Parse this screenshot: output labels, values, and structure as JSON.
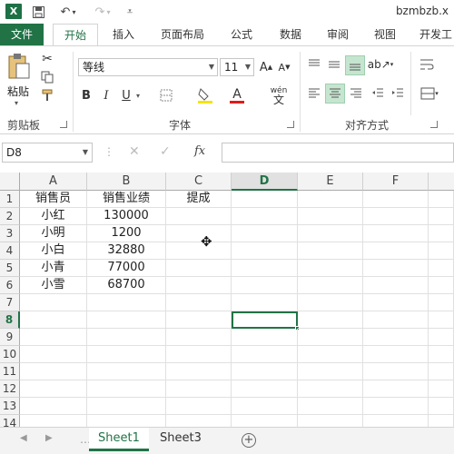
{
  "window": {
    "title": "bzmbzb.x"
  },
  "quick_access": {
    "save_icon": "save-icon",
    "undo_icon": "undo-icon",
    "redo_icon": "redo-icon",
    "customize_icon": "customize-icon"
  },
  "ribbon_tabs": [
    "文件",
    "开始",
    "插入",
    "页面布局",
    "公式",
    "数据",
    "审阅",
    "视图",
    "开发工"
  ],
  "active_tab": "开始",
  "clipboard": {
    "paste_label": "粘贴",
    "group_label": "剪贴板"
  },
  "font": {
    "name": "等线",
    "size": "11",
    "group_label": "字体",
    "wen_label": "wén",
    "wen_char": "文"
  },
  "alignment": {
    "group_label": "对齐方式"
  },
  "formula_bar": {
    "name_box": "D8",
    "fx": "fx",
    "formula": ""
  },
  "grid": {
    "columns": [
      "A",
      "B",
      "C",
      "D",
      "E",
      "F"
    ],
    "rows": [
      "1",
      "2",
      "3",
      "4",
      "5",
      "6",
      "7",
      "8",
      "9",
      "10",
      "11",
      "12",
      "13",
      "14"
    ],
    "selected_column": "D",
    "selected_row": "8",
    "cells": {
      "A1": "销售员",
      "B1": "销售业绩",
      "C1": "提成",
      "A2": "小红",
      "B2": "130000",
      "A3": "小明",
      "B3": "1200",
      "A4": "小白",
      "B4": "32880",
      "A5": "小青",
      "B5": "77000",
      "A6": "小雪",
      "B6": "68700"
    }
  },
  "sheets": [
    "Sheet1",
    "Sheet3"
  ],
  "active_sheet": "Sheet1",
  "colors": {
    "excel_green": "#217346",
    "file_tab": "#217346",
    "highlight": "#c6e5d0"
  }
}
